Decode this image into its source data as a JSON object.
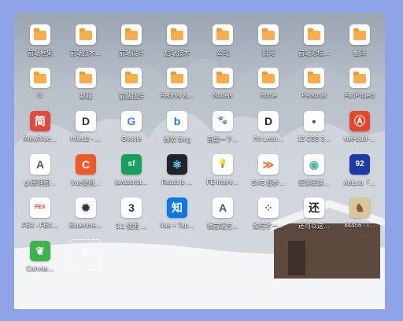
{
  "tiles": [
    {
      "label": "前端框架",
      "icon": "folder-icon",
      "kind": "folder"
    },
    {
      "label": "前端技术…",
      "icon": "folder-icon",
      "kind": "folder"
    },
    {
      "label": "前端设计",
      "icon": "folder-icon",
      "kind": "folder"
    },
    {
      "label": "后端技术",
      "icon": "folder-icon",
      "kind": "folder"
    },
    {
      "label": "公司",
      "icon": "folder-icon",
      "kind": "folder"
    },
    {
      "label": "旧网",
      "icon": "folder-icon",
      "kind": "folder"
    },
    {
      "label": "前端论坛…",
      "icon": "folder-icon",
      "kind": "folder"
    },
    {
      "label": "翻译",
      "icon": "folder-icon",
      "kind": "folder"
    },
    {
      "label": "IT",
      "icon": "folder-icon",
      "kind": "folder"
    },
    {
      "label": "邮箱",
      "icon": "folder-icon",
      "kind": "folder"
    },
    {
      "label": "前端插件",
      "icon": "folder-icon",
      "kind": "folder"
    },
    {
      "label": "RedHat &…",
      "icon": "folder-icon",
      "kind": "folder"
    },
    {
      "label": "Nodejs",
      "icon": "folder-icon",
      "kind": "folder"
    },
    {
      "label": "Home",
      "icon": "folder-icon",
      "kind": "folder"
    },
    {
      "label": "Personal",
      "icon": "folder-icon",
      "kind": "folder"
    },
    {
      "label": "FunProject",
      "icon": "folder-icon",
      "kind": "folder"
    },
    {
      "label": "[New]Vue…",
      "icon": "jian-icon",
      "kind": "glyph",
      "glyph": "简",
      "fg": "#ffffff",
      "bg": "#e04c3c"
    },
    {
      "label": "Howdz - …",
      "icon": "howdz-icon",
      "kind": "glyph",
      "glyph": "D",
      "fg": "#333333",
      "bg": "#ffffff"
    },
    {
      "label": "Google",
      "icon": "google-icon",
      "kind": "glyph",
      "glyph": "G",
      "fg": "#4285f4",
      "bg": "#ffffff"
    },
    {
      "label": "微软 Bing",
      "icon": "bing-icon",
      "kind": "glyph",
      "glyph": "b",
      "fg": "#1e7bd6",
      "bg": "#ffffff"
    },
    {
      "label": "百度一下…",
      "icon": "baidu-icon",
      "kind": "glyph",
      "glyph": "🐾",
      "fg": "#2932e1",
      "bg": "#ffffff"
    },
    {
      "label": "I'm Leon…",
      "icon": "leon-icon",
      "kind": "glyph",
      "glyph": "D",
      "fg": "#222222",
      "bg": "#ffffff"
    },
    {
      "label": "12 CSS 3…",
      "icon": "css-doc-icon",
      "kind": "glyph",
      "glyph": "▪",
      "fg": "#444444",
      "bg": "#ffffff"
    },
    {
      "label": "vue-quill-…",
      "icon": "quill-icon",
      "kind": "glyph",
      "glyph": "Ⓐ",
      "fg": "#ffffff",
      "bg": "#e8462a"
    },
    {
      "label": "git原理图…",
      "icon": "git-doc-icon",
      "kind": "glyph",
      "glyph": "A",
      "fg": "#555555",
      "bg": "#ffffff"
    },
    {
      "label": "Vue使用…",
      "icon": "csdn-icon",
      "kind": "glyph",
      "glyph": "C",
      "fg": "#ffffff",
      "bg": "#f05a28"
    },
    {
      "label": "javascript…",
      "icon": "segmentfault-icon",
      "kind": "glyph",
      "glyph": "sf",
      "fg": "#ffffff",
      "bg": "#17a05d"
    },
    {
      "label": "React.js …",
      "icon": "react-icon",
      "kind": "glyph",
      "glyph": "⚛",
      "fg": "#61dafb",
      "bg": "#20232a"
    },
    {
      "label": "FE-Interv…",
      "icon": "lightbulb-icon",
      "kind": "glyph",
      "glyph": "💡",
      "fg": "#f5c400",
      "bg": "#ffffff"
    },
    {
      "label": "SVG 起步…",
      "icon": "svg-icon",
      "kind": "glyph",
      "glyph": "≫",
      "fg": "#f26b1d",
      "bg": "#ffffff"
    },
    {
      "label": "阅读阅读…",
      "icon": "reader-icon",
      "kind": "glyph",
      "glyph": "◉",
      "fg": "#4fb3a5",
      "bg": "#ffffff"
    },
    {
      "label": "Aotu.io「…",
      "icon": "aotu-icon",
      "kind": "glyph",
      "glyph": "92",
      "fg": "#ffffff",
      "bg": "#1d3aa6"
    },
    {
      "label": "FEX - FEX…",
      "icon": "fex-icon",
      "kind": "glyph",
      "glyph": "FEX",
      "fg": "#e0422e",
      "bg": "#ffffff"
    },
    {
      "label": "Experime…",
      "icon": "bug-icon",
      "kind": "glyph",
      "glyph": "✹",
      "fg": "#333333",
      "bg": "#ffffff"
    },
    {
      "label": "3.1 使用 …",
      "icon": "number-three-icon",
      "kind": "glyph",
      "glyph": "3",
      "fg": "#333333",
      "bg": "#ffffff"
    },
    {
      "label": "Vue + Typ…",
      "icon": "zhihu-icon",
      "kind": "glyph",
      "glyph": "知",
      "fg": "#ffffff",
      "bg": "#0a79e6"
    },
    {
      "label": "微前端方…",
      "icon": "doc-a-icon",
      "kind": "glyph",
      "glyph": "A",
      "fg": "#555555",
      "bg": "#ffffff"
    },
    {
      "label": "如何写一…",
      "icon": "dots-grid-icon",
      "kind": "glyph",
      "glyph": "⁘",
      "fg": "#7a4cc2",
      "bg": "#ffffff"
    },
    {
      "label": "还可以这…",
      "icon": "huan-icon",
      "kind": "glyph",
      "glyph": "还",
      "fg": "#222222",
      "bg": "#ffffff"
    },
    {
      "label": "84456 - I…",
      "icon": "avatar-icon",
      "kind": "glyph",
      "glyph": "♞",
      "fg": "#8b5a2b",
      "bg": "#d8c79a"
    },
    {
      "label": "Canvas…",
      "icon": "leaf-icon",
      "kind": "glyph",
      "glyph": "❦",
      "fg": "#ffffff",
      "bg": "#3cb44a"
    }
  ],
  "add_button": {
    "label": "+"
  }
}
